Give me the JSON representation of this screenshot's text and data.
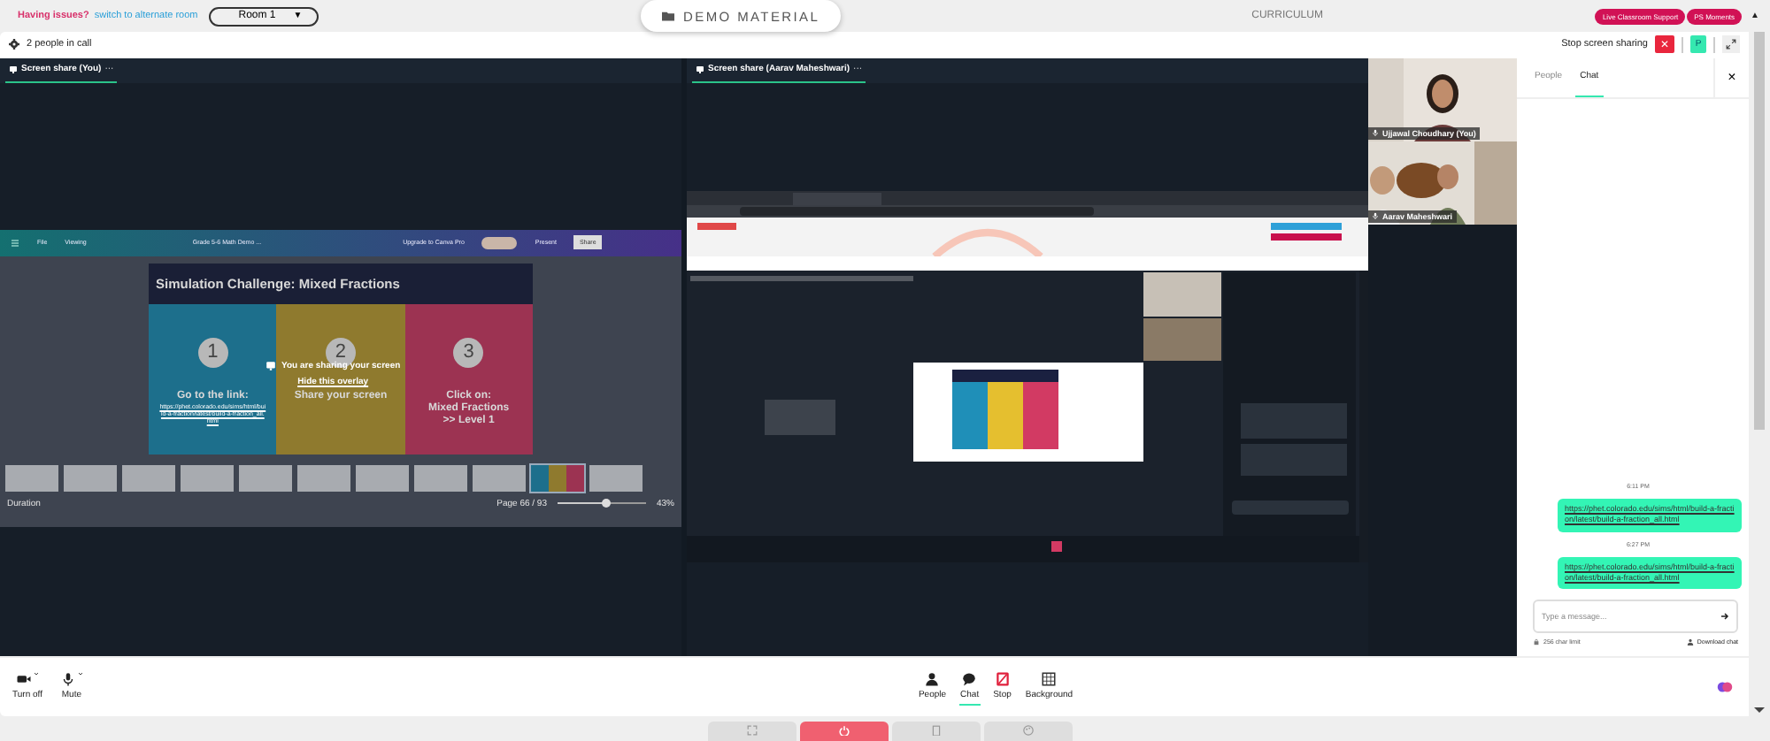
{
  "top_bar": {
    "issue_text": "Having issues?",
    "switch_link": "switch to alternate room",
    "room_select": "Room 1",
    "room_caret": "▼",
    "demo_button": "DEMO MATERIAL",
    "curriculum": "CURRICULUM",
    "support_buttons": [
      "Live Classroom Support",
      "PS Moments"
    ],
    "collapse": "▲"
  },
  "call_bar": {
    "people_count": "2 people in call",
    "stop_label": "Stop screen sharing",
    "stop_icon": "✕",
    "avatar": "P"
  },
  "screens": [
    {
      "title": "Screen share (You)",
      "menu": "···",
      "content": {
        "kind": "slides",
        "app_bar": {
          "menu": "File",
          "mode": "Viewing",
          "doc_title": "Grade 5-6 Math Demo ...",
          "upgrade": "Upgrade to Canva Pro",
          "present": "Present",
          "share": "Share"
        },
        "slide_title": "Simulation Challenge: Mixed Fractions",
        "steps": [
          {
            "number": "1",
            "color": "#1d6f8c",
            "lines": [
              "Go to the link:"
            ],
            "link": "https://phet.colorado.edu/sims/html/build-a-fraction/latest/build-a-fraction_all.html"
          },
          {
            "number": "2",
            "color": "#8f7a2e",
            "lines": [
              "Share your screen"
            ]
          },
          {
            "number": "3",
            "color": "#9c3352",
            "lines": [
              "Click on:",
              "Mixed Fractions",
              ">> Level 1"
            ]
          }
        ],
        "overlay": {
          "text": "You are sharing your screen",
          "link": "Hide this overlay"
        },
        "footer": {
          "duration": "Duration",
          "page": "Page 66 / 93",
          "zoom": "43%",
          "zoom_slider": {
            "level": 0.55
          }
        }
      }
    },
    {
      "title": "Screen share (Aarav Maheshwari)",
      "menu": "···",
      "content": {
        "kind": "nested"
      }
    }
  ],
  "participants": [
    {
      "name": "Ujjawal Choudhary (You)"
    },
    {
      "name": "Aarav Maheshwari"
    }
  ],
  "chat": {
    "tabs": [
      {
        "label": "People",
        "selected": false
      },
      {
        "label": "Chat",
        "selected": true
      }
    ],
    "close": "×",
    "messages": [
      {
        "time": "6:11 PM",
        "text": "https://phet.colorado.edu/sims/html/build-a-fraction/latest/build-a-fraction_all.html"
      },
      {
        "time": "6:27 PM",
        "text": "https://phet.colorado.edu/sims/html/build-a-fraction/latest/build-a-fraction_all.html"
      }
    ],
    "placeholder": "Type a message...",
    "char_limit": "256 char limit",
    "download": "Download chat"
  },
  "toolbar": {
    "left": [
      {
        "kind": "camera",
        "label": "Turn off"
      },
      {
        "kind": "mic",
        "label": "Mute"
      }
    ],
    "right": [
      {
        "kind": "people",
        "label": "People",
        "selected": false
      },
      {
        "kind": "chat",
        "label": "Chat",
        "selected": true
      },
      {
        "kind": "stop",
        "label": "Stop",
        "selected": false
      },
      {
        "kind": "background",
        "label": "Background",
        "selected": false
      }
    ]
  },
  "bottom_buttons": [
    {
      "kind": "fullscreen"
    },
    {
      "kind": "power"
    },
    {
      "kind": "document"
    },
    {
      "kind": "palette"
    }
  ]
}
